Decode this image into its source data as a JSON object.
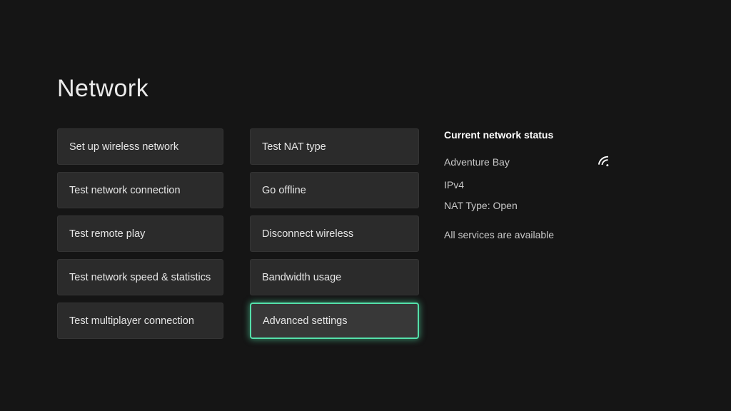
{
  "page": {
    "title": "Network"
  },
  "menu": {
    "left_column": [
      {
        "label": "Set up wireless network"
      },
      {
        "label": "Test network connection"
      },
      {
        "label": "Test remote play"
      },
      {
        "label": "Test network speed & statistics"
      },
      {
        "label": "Test multiplayer connection"
      }
    ],
    "right_column": [
      {
        "label": "Test NAT type"
      },
      {
        "label": "Go offline"
      },
      {
        "label": "Disconnect wireless"
      },
      {
        "label": "Bandwidth usage"
      },
      {
        "label": "Advanced settings",
        "selected": true
      }
    ]
  },
  "status_panel": {
    "heading": "Current network status",
    "network_name": "Adventure Bay",
    "ip_version": "IPv4",
    "nat_type": "NAT Type: Open",
    "services": "All services are available",
    "wifi_icon": "wifi-signal-icon"
  },
  "colors": {
    "background": "#151515",
    "button_background": "#2b2b2b",
    "accent": "#54e0aa",
    "text": "#e6e6e6"
  }
}
